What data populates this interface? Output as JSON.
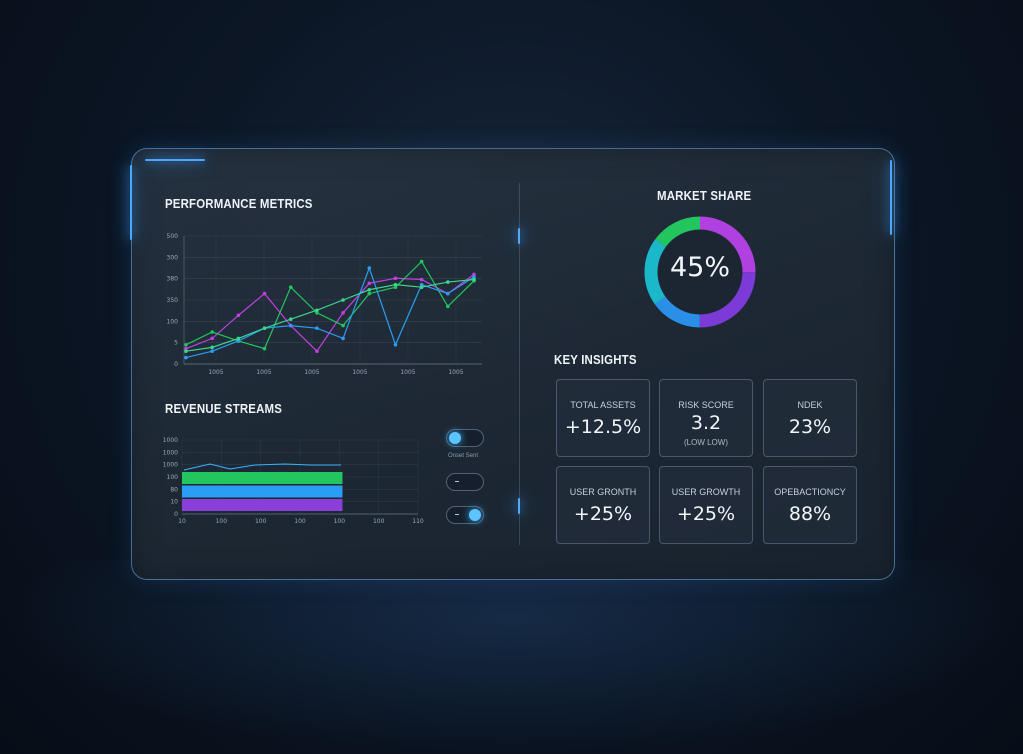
{
  "performance": {
    "title": "PERFORMANCE METRICS",
    "chart_data": {
      "type": "line",
      "title": "PERFORMANCE METRICS",
      "x": [
        "1005",
        "1005",
        "1005",
        "1005",
        "1005",
        "1005"
      ],
      "y_ticks": [
        "500",
        "300",
        "380",
        "350",
        "100",
        "5",
        "0"
      ],
      "grid": true,
      "series": [
        {
          "color": "#c040e0",
          "values": [
            0.12,
            0.2,
            0.38,
            0.55,
            0.3,
            0.1,
            0.4,
            0.63,
            0.67,
            0.66,
            0.55,
            0.7
          ]
        },
        {
          "color": "#22c55e",
          "values": [
            0.15,
            0.25,
            0.18,
            0.12,
            0.6,
            0.4,
            0.3,
            0.55,
            0.6,
            0.8,
            0.45,
            0.65
          ]
        },
        {
          "color": "#2a9df4",
          "values": [
            0.05,
            0.1,
            0.18,
            0.28,
            0.3,
            0.28,
            0.2,
            0.75,
            0.15,
            0.62,
            0.55,
            0.68
          ]
        },
        {
          "color": "#3dd68c",
          "values": [
            0.1,
            0.13,
            0.2,
            0.28,
            0.35,
            0.42,
            0.5,
            0.58,
            0.62,
            0.6,
            0.64,
            0.66
          ]
        }
      ]
    }
  },
  "revenue": {
    "title": "REVENUE STREAMS",
    "chart_data": {
      "type": "bar",
      "title": "REVENUE STREAMS",
      "x_ticks": [
        "10",
        "100",
        "100",
        "100",
        "100",
        "100",
        "110"
      ],
      "y_ticks": [
        "1000",
        "1000",
        "1000",
        "100",
        "80",
        "10",
        "0"
      ],
      "series": [
        {
          "color": "#22c55e",
          "value": 0.68
        },
        {
          "color": "#2a9df4",
          "value": 0.68
        },
        {
          "color": "#8b3fd9",
          "value": 0.68
        }
      ],
      "trend_color": "#38b6ff"
    }
  },
  "toggles": {
    "caption": "Onset Sent",
    "items": [
      {
        "state": "on",
        "knob": "left"
      },
      {
        "state": "off",
        "knob": "none"
      },
      {
        "state": "on",
        "knob": "right"
      }
    ]
  },
  "market_share": {
    "title": "MARKET SHARE",
    "value_label": "45%",
    "chart_data": {
      "type": "pie",
      "slices": [
        {
          "color": "#b040e0",
          "value": 25
        },
        {
          "color": "#7c3ad6",
          "value": 25
        },
        {
          "color": "#2a8fe6",
          "value": 15
        },
        {
          "color": "#1ab8c8",
          "value": 20
        },
        {
          "color": "#22c55e",
          "value": 15
        }
      ]
    }
  },
  "insights": {
    "title": "KEY INSIGHTS",
    "cards": [
      {
        "label": "TOTAL ASSETS",
        "value": "+12.5%",
        "sub": ""
      },
      {
        "label": "RISK SCORE",
        "value": "3.2",
        "sub": "(LOW LOW)"
      },
      {
        "label": "NDEK",
        "value": "23%",
        "sub": ""
      },
      {
        "label": "USER GRONTH",
        "value": "+25%",
        "sub": ""
      },
      {
        "label": "USER GROWTH",
        "value": "+25%",
        "sub": ""
      },
      {
        "label": "OPEBACTIONCY",
        "value": "88%",
        "sub": ""
      }
    ]
  }
}
